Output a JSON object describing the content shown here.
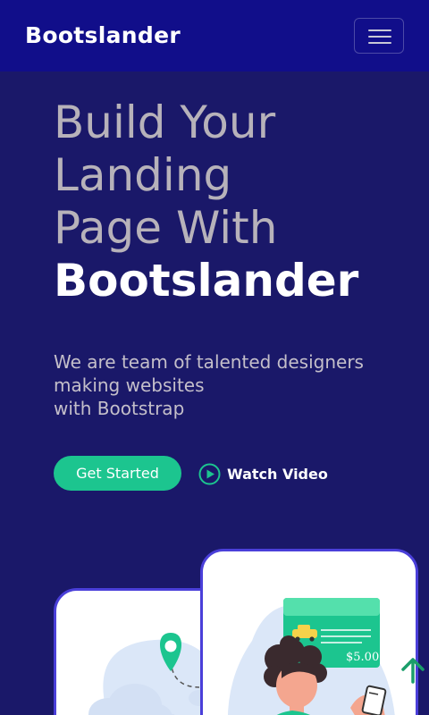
{
  "navbar": {
    "brand": "Bootslander",
    "menu_icon": "hamburger-menu-icon"
  },
  "hero": {
    "headline_lines": [
      "Build Your",
      "Landing",
      "Page With"
    ],
    "headline_emphasis": "Bootslander",
    "subtitle_lines": [
      "We are team of talented designers",
      "making websites",
      "with Bootstrap"
    ]
  },
  "actions": {
    "primary_label": "Get Started",
    "secondary_label": "Watch Video",
    "secondary_icon": "play-circle-icon"
  },
  "illustration": {
    "price_label": "$5.00",
    "icons": [
      "map-pin-icon",
      "cloud-icon",
      "taxi-icon",
      "phone-icon"
    ]
  },
  "floating": {
    "icon": "arrow-up-icon"
  },
  "colors": {
    "navbar_bg": "#110e8a",
    "page_bg": "#1a1869",
    "accent": "#1cc58f",
    "card_border": "#4a3fd9"
  }
}
